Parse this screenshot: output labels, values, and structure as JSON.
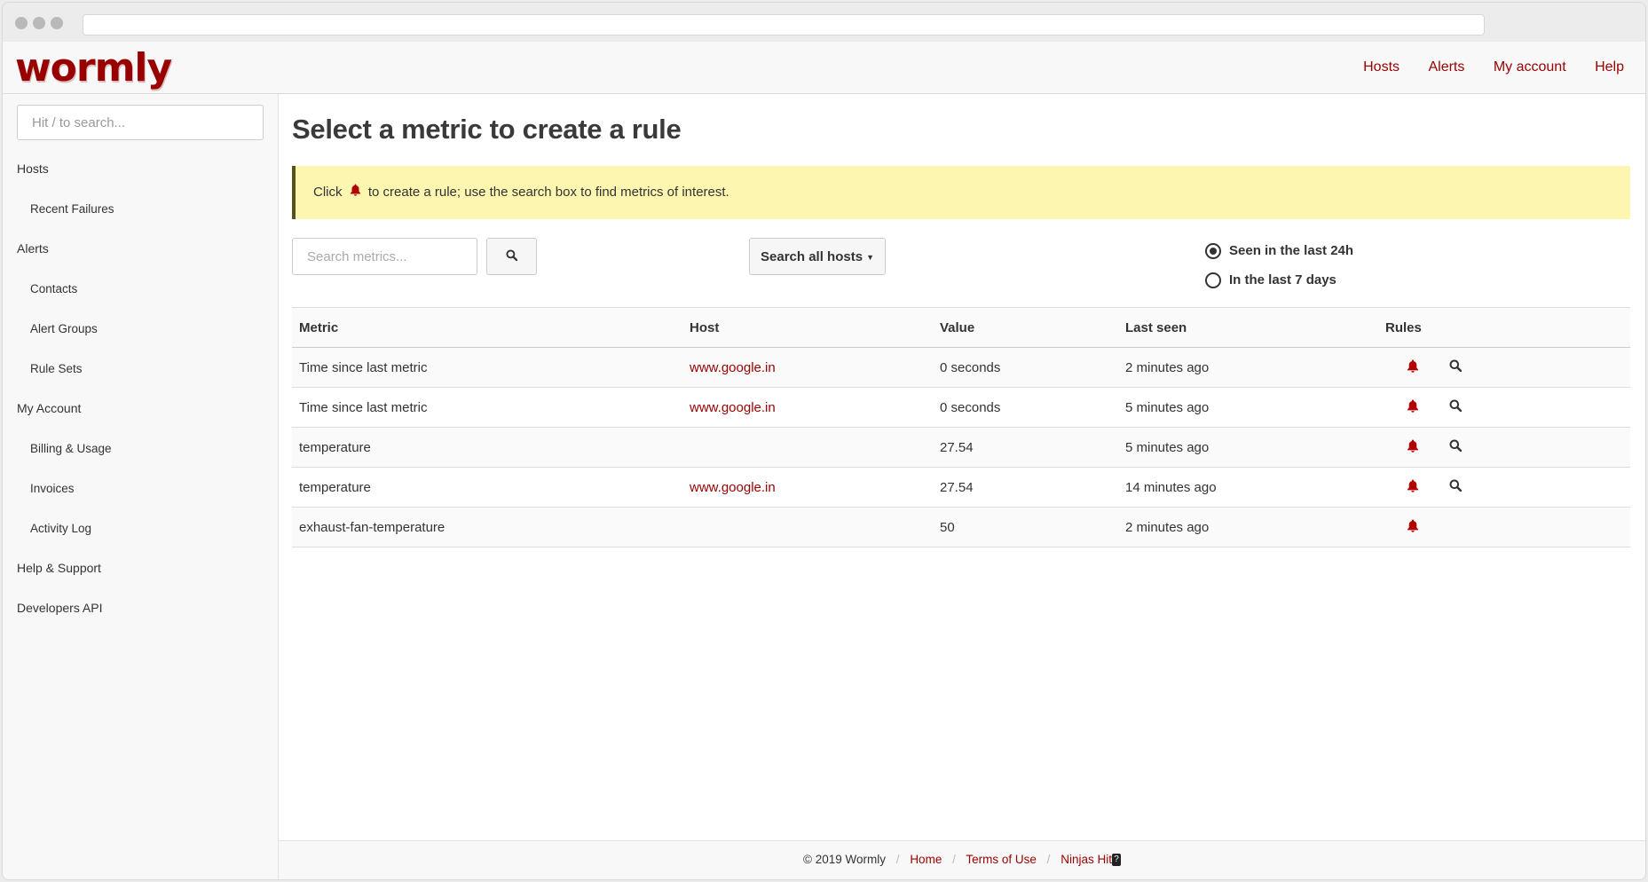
{
  "brand": {
    "logo_text": "wormly",
    "color": "#990000"
  },
  "nav": [
    "Hosts",
    "Alerts",
    "My account",
    "Help"
  ],
  "sidebar": {
    "search_placeholder": "Hit / to search...",
    "items": [
      {
        "label": "Hosts",
        "sub": false
      },
      {
        "label": "Recent Failures",
        "sub": true
      },
      {
        "label": "Alerts",
        "sub": false
      },
      {
        "label": "Contacts",
        "sub": true
      },
      {
        "label": "Alert Groups",
        "sub": true
      },
      {
        "label": "Rule Sets",
        "sub": true
      },
      {
        "label": "My Account",
        "sub": false
      },
      {
        "label": "Billing & Usage",
        "sub": true
      },
      {
        "label": "Invoices",
        "sub": true
      },
      {
        "label": "Activity Log",
        "sub": true
      },
      {
        "label": "Help & Support",
        "sub": false
      },
      {
        "label": "Developers API",
        "sub": false
      }
    ]
  },
  "main": {
    "title": "Select a metric to create a rule",
    "notice": {
      "before": "Click",
      "after": "to create a rule; use the search box to find metrics of interest."
    },
    "search_placeholder": "Search metrics...",
    "hosts_button": "Search all hosts",
    "radios": [
      {
        "label": "Seen in the last 24h",
        "checked": true
      },
      {
        "label": "In the last 7 days",
        "checked": false
      }
    ]
  },
  "table": {
    "headers": [
      "Metric",
      "Host",
      "Value",
      "Last seen",
      "Rules"
    ],
    "rows": [
      {
        "metric": "Time since last metric",
        "host": "www.google.in",
        "value": "0 seconds",
        "last_seen": "2 minutes ago",
        "search": true
      },
      {
        "metric": "Time since last metric",
        "host": "www.google.in",
        "value": "0 seconds",
        "last_seen": "5 minutes ago",
        "search": true
      },
      {
        "metric": "temperature",
        "host": "",
        "value": "27.54",
        "last_seen": "5 minutes ago",
        "search": true
      },
      {
        "metric": "temperature",
        "host": "www.google.in",
        "value": "27.54",
        "last_seen": "14 minutes ago",
        "search": true
      },
      {
        "metric": "exhaust-fan-temperature",
        "host": "",
        "value": "50",
        "last_seen": "2 minutes ago",
        "search": false
      }
    ]
  },
  "footer": {
    "copyright": "© 2019 Wormly",
    "links": [
      "Home",
      "Terms of Use",
      "Ninjas Hit"
    ],
    "badge": "?"
  },
  "icons": {
    "bell": "bell-icon",
    "search": "search-icon",
    "accent": "#b00000"
  }
}
